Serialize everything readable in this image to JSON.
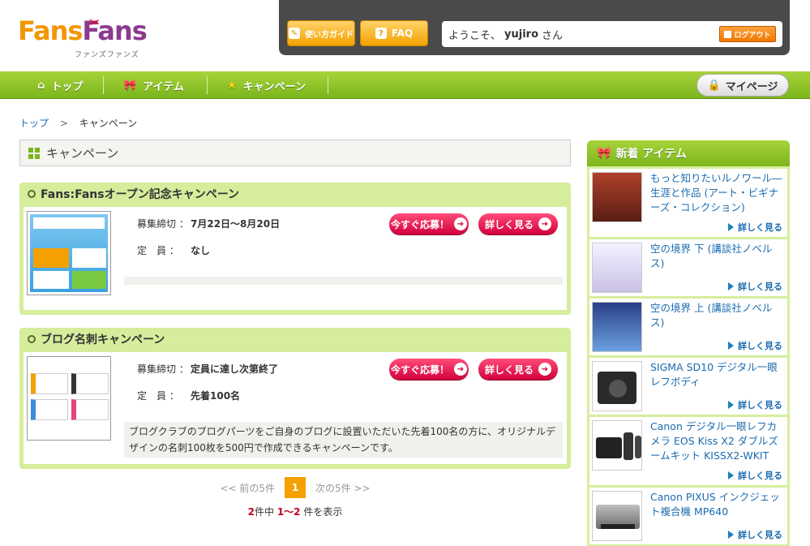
{
  "logo": {
    "text_a": "Fans",
    "text_b": "Fans",
    "sub": "ファンズファンズ"
  },
  "topbar": {
    "guide_label": "使い方ガイド",
    "faq_label": "FAQ",
    "welcome_prefix": "ようこそ、",
    "username": "yujiro",
    "welcome_suffix": "さん",
    "logout_label": "ログアウト"
  },
  "nav": {
    "top": "トップ",
    "items": "アイテム",
    "campaign": "キャンペーン",
    "mypage": "マイページ"
  },
  "breadcrumb": {
    "home": "トップ",
    "sep": ">",
    "current": "キャンペーン"
  },
  "page_title": "キャンペーン",
  "campaigns": [
    {
      "title": "Fans:Fansオープン記念キャンペーン",
      "deadline_label": "募集締切 ：",
      "deadline": "7月22日〜8月20日",
      "quota_label": "定　員 ：",
      "quota": "なし",
      "apply_label": "今すぐ応募！",
      "detail_label": "詳しく見る",
      "description": ""
    },
    {
      "title": "ブログ名刺キャンペーン",
      "deadline_label": "募集締切 ：",
      "deadline": "定員に達し次第終了",
      "quota_label": "定　員 ：",
      "quota": "先着100名",
      "apply_label": "今すぐ応募！",
      "detail_label": "詳しく見る",
      "description": "ブログクラブのブログパーツをご自身のブログに設置いただいた先着100名の方に、オリジナルデザインの名刺100枚を500円で作成できるキャンペーンです。"
    }
  ],
  "pager": {
    "prev": "<< 前の5件",
    "current": "1",
    "next": "次の5件 >>"
  },
  "count": {
    "total": "2",
    "of_label": "件中",
    "range": "1〜2",
    "suffix": "件を表示"
  },
  "sidebar": {
    "title": "新着 アイテム",
    "more_label": "詳しく見る",
    "items": [
      {
        "title": "もっと知りたいルノワール―生涯と作品 (アート・ビギナーズ・コレクション)"
      },
      {
        "title": "空の境界 下 (講談社ノベルス)"
      },
      {
        "title": "空の境界 上 (講談社ノベルス)"
      },
      {
        "title": "SIGMA SD10 デジタル一眼レフボディ"
      },
      {
        "title": "Canon デジタル一眼レフカメラ EOS Kiss X2 ダブルズームキット KISSX2-WKIT"
      },
      {
        "title": "Canon PIXUS インクジェット複合機 MP640"
      }
    ]
  },
  "colors": {
    "green": "#7bb51c",
    "orange": "#f3a000",
    "red": "#d4003c",
    "link": "#1a6bb0"
  }
}
